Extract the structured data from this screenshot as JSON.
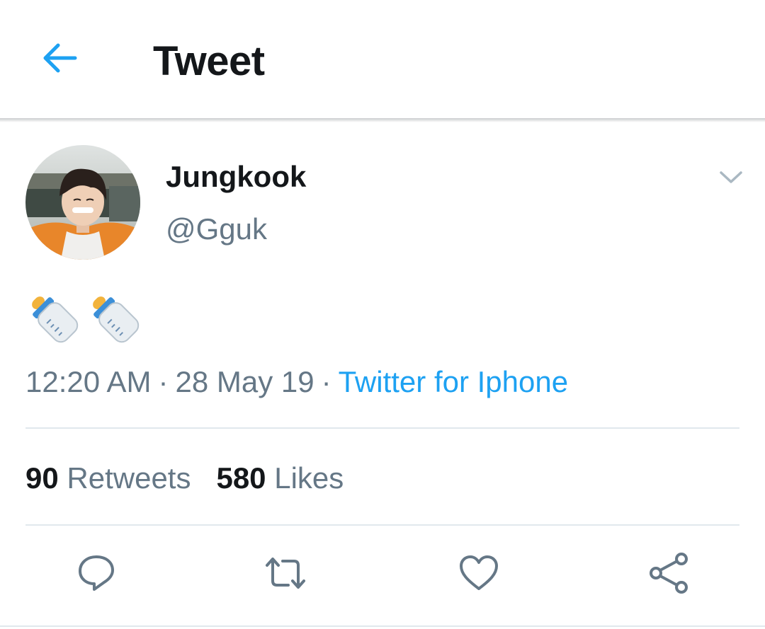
{
  "header": {
    "title": "Tweet",
    "back_icon": "arrow-left-icon",
    "accent": "#1da1f2"
  },
  "tweet": {
    "author": {
      "name": "Jungkook",
      "handle": "@Gguk"
    },
    "emojis": [
      "baby-bottle-emoji",
      "baby-bottle-emoji"
    ],
    "time": "12:20 AM",
    "date": "28 May 19",
    "separator": "·",
    "source": "Twitter for Iphone",
    "menu_icon": "chevron-down-icon"
  },
  "stats": {
    "retweets_count": "90",
    "retweets_label": "Retweets",
    "likes_count": "580",
    "likes_label": "Likes"
  },
  "actions": [
    "reply-icon",
    "retweet-icon",
    "like-icon",
    "share-icon"
  ],
  "colors": {
    "text": "#14171a",
    "secondary": "#657786",
    "link": "#1da1f2",
    "icon": "#657786",
    "divider": "#e1e8ed"
  }
}
